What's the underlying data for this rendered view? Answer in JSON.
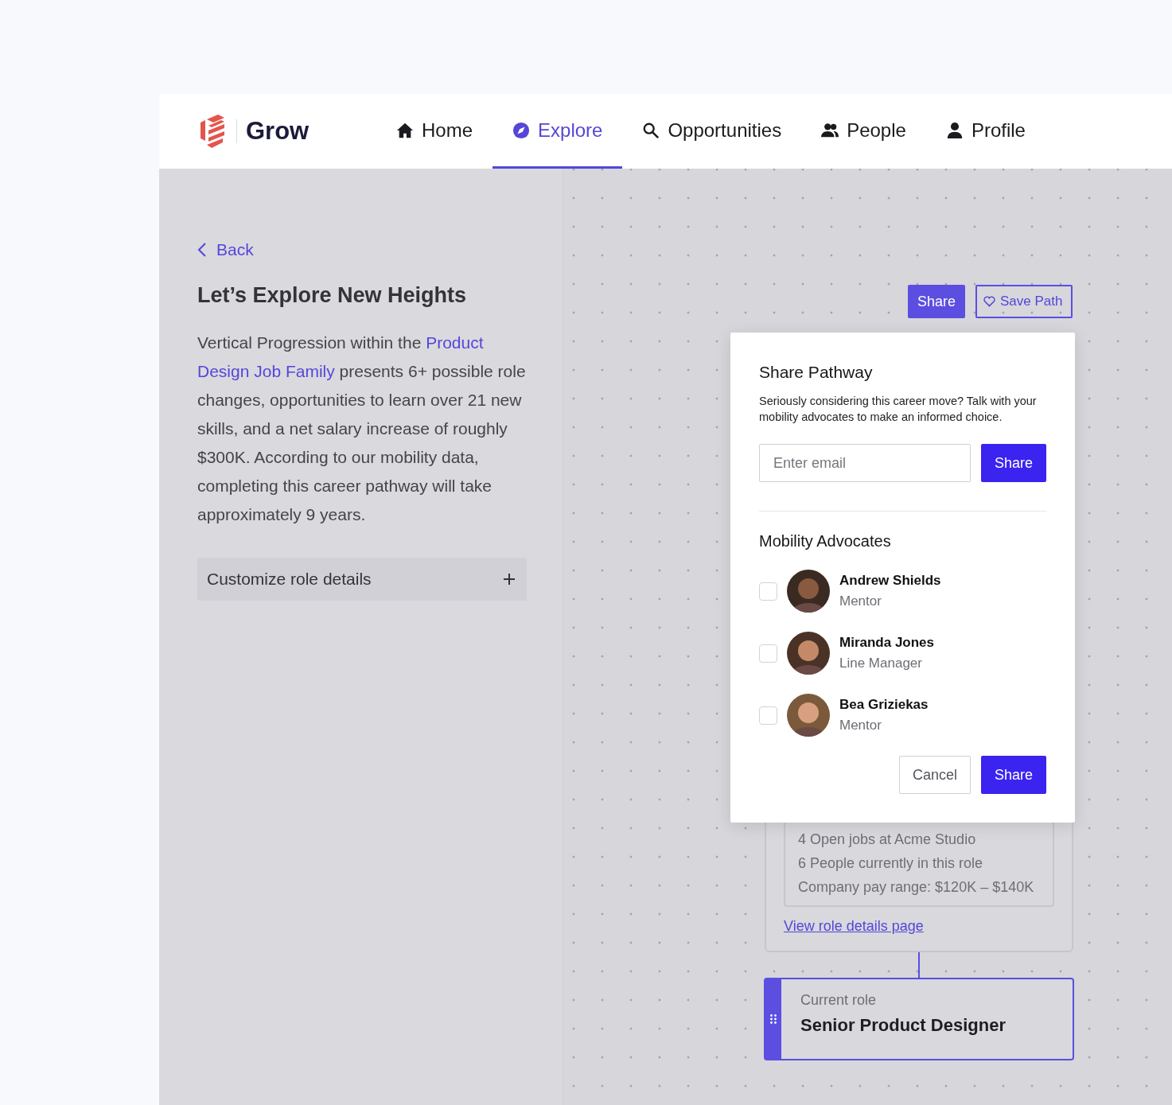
{
  "header": {
    "brand": "Grow",
    "nav": [
      {
        "label": "Home",
        "selected": false
      },
      {
        "label": "Explore",
        "selected": true
      },
      {
        "label": "Opportunities",
        "selected": false
      },
      {
        "label": "People",
        "selected": false
      },
      {
        "label": "Profile",
        "selected": false
      }
    ]
  },
  "sidebar": {
    "back": "Back",
    "title": "Let’s Explore New Heights",
    "description": [
      {
        "text": "Vertical Progression within the "
      },
      {
        "text": "Product",
        "kind": "link"
      },
      {
        "text": "Design Job Family",
        "kind": "link"
      },
      {
        "text": " presents 6+ possible role changes, opportunities to learn over 21 new skills, and a net salary increase of roughly $300K. According to our mobility data, completing this career pathway will take approximately 9 years."
      }
    ],
    "accordion": {
      "label": "Customize role details",
      "expanded": false
    }
  },
  "canvas": {
    "actions": [
      {
        "label": "Share",
        "kind": "primary"
      },
      {
        "label": "Save Path",
        "kind": "outline"
      }
    ],
    "role_card": {
      "stats": [
        "4 Open jobs at Acme Studio",
        "6 People currently in this role",
        "Company pay range: $120K – $140K"
      ],
      "link": "View role details page"
    },
    "current_role": {
      "caption": "Current role",
      "title": "Senior Product Designer"
    }
  },
  "dialog": {
    "title": "Share Pathway",
    "description": "Seriously considering this career move? Talk with your mobility advocates to make an informed choice.",
    "email": {
      "placeholder": "Enter email"
    },
    "send": "Share",
    "section_title": "Mobility Advocates",
    "advocates": [
      {
        "name": "Andrew Shields",
        "role": "Mentor",
        "checked": false
      },
      {
        "name": "Miranda Jones",
        "role": "Line Manager",
        "checked": false
      },
      {
        "name": "Bea Griziekas",
        "role": "Mentor",
        "checked": false
      }
    ],
    "buttons": [
      {
        "label": "Cancel",
        "kind": "secondary"
      },
      {
        "label": "Share",
        "kind": "primary"
      }
    ]
  }
}
